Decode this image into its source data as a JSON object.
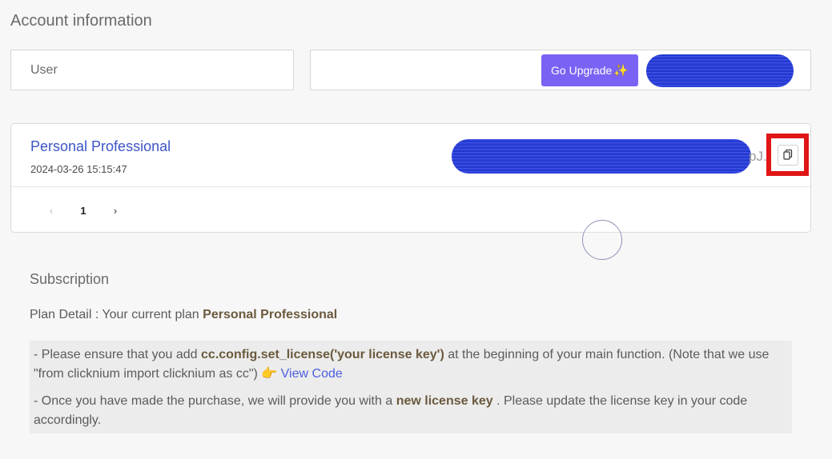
{
  "header": {
    "title": "Account information"
  },
  "account": {
    "user_label": "User",
    "upgrade_button": "Go Upgrade",
    "upgrade_icon": "sparkle-icon"
  },
  "license": {
    "plan_name": "Personal Professional",
    "created_at": "2024-03-26 15:15:47",
    "key_suffix": "pJ.",
    "copy_icon": "copy-icon"
  },
  "pagination": {
    "prev": "‹",
    "current": "1",
    "next": "›"
  },
  "subscription": {
    "title": "Subscription",
    "plan_detail_prefix": "Plan Detail : Your current plan ",
    "plan_detail_plan": "Personal Professional",
    "notice": {
      "line1_a": "- Please ensure that you add ",
      "line1_code": "cc.config.set_license('your license key')",
      "line1_b": " at the beginning of your main function. (Note that we use \"from clicknium import clicknium as cc\") ",
      "view_code": "View Code",
      "line2_a": "- Once you have made the purchase, we will provide you with a ",
      "line2_bold": "new license key",
      "line2_b": " . Please update the license key in your code accordingly."
    }
  },
  "colors": {
    "accent": "#7a63f4",
    "link": "#3d55c9",
    "highlight": "#e01515",
    "redaction": "#2a3fd8"
  }
}
